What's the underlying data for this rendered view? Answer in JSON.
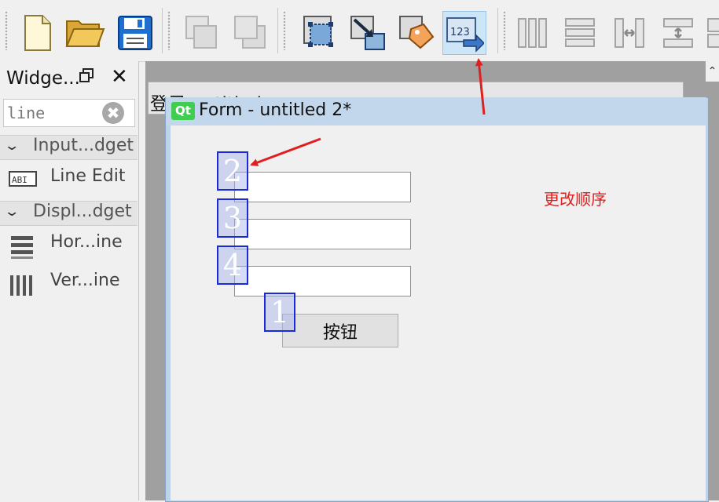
{
  "toolbar": {
    "buttons": [
      {
        "name": "new-file-icon"
      },
      {
        "name": "open-folder-icon"
      },
      {
        "name": "save-icon"
      },
      {
        "name": "bring-to-front-icon"
      },
      {
        "name": "send-to-back-icon"
      },
      {
        "name": "edit-widgets-icon"
      },
      {
        "name": "edit-signals-slots-icon"
      },
      {
        "name": "edit-buddies-icon"
      },
      {
        "name": "edit-tab-order-icon",
        "active": true
      },
      {
        "name": "layout-horizontal-icon"
      },
      {
        "name": "layout-vertical-icon"
      },
      {
        "name": "layout-horizontal-splitter-icon"
      },
      {
        "name": "layout-vertical-splitter-icon"
      }
    ],
    "tab_order_label": "123"
  },
  "widget_box": {
    "title": "Widge...",
    "float_icon": "ᴮ",
    "close_icon": "✕",
    "filter": {
      "value": "line",
      "clear_icon": "✖"
    },
    "categories": [
      {
        "label": "Input...dget",
        "items": [
          {
            "label": "Line Edit",
            "icon_text": "ABI"
          }
        ]
      },
      {
        "label": "Displ...dget",
        "items": [
          {
            "label": "Hor...ine"
          },
          {
            "label": "Ver...ine"
          }
        ]
      }
    ]
  },
  "background_window": {
    "title": "登录 untitled"
  },
  "form_window": {
    "badge": "Qt",
    "title": "Form - untitled 2*",
    "push_button_label": "按钮",
    "tab_order_numbers": [
      "2",
      "3",
      "4",
      "1"
    ]
  },
  "annotation": {
    "text": "更改顺序",
    "color": "#e02020"
  },
  "colors": {
    "tab_order_box": "#1a2ad8",
    "annotation_arrow": "#e02020",
    "qt_green": "#41cd52"
  }
}
